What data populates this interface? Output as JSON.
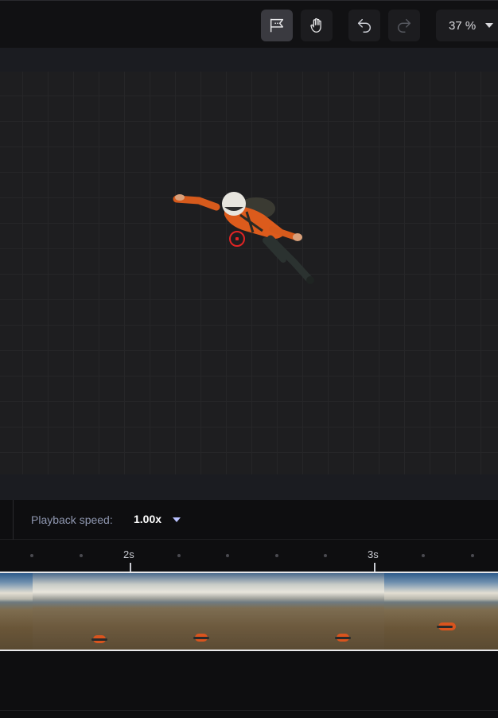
{
  "toolbar": {
    "tools": [
      {
        "name": "annotate-tool",
        "icon": "flag-chat-icon",
        "active": true
      },
      {
        "name": "pan-tool",
        "icon": "hand-icon",
        "active": false
      },
      {
        "name": "undo",
        "icon": "undo-icon",
        "active": false
      },
      {
        "name": "redo",
        "icon": "redo-icon",
        "active": false
      }
    ],
    "zoom": "37 %"
  },
  "canvas": {
    "subject": "skydiver-image",
    "marker_icon": "target-circle-icon",
    "marker_color": "#e02424"
  },
  "playback": {
    "label": "Playback speed:",
    "value": "1.00x"
  },
  "timeline": {
    "ticks": [
      "2s",
      "3s"
    ],
    "frames": 6
  },
  "colors": {
    "background": "#0f0f10",
    "canvas": "#1e1e20",
    "accent": "#b9c2ff"
  }
}
